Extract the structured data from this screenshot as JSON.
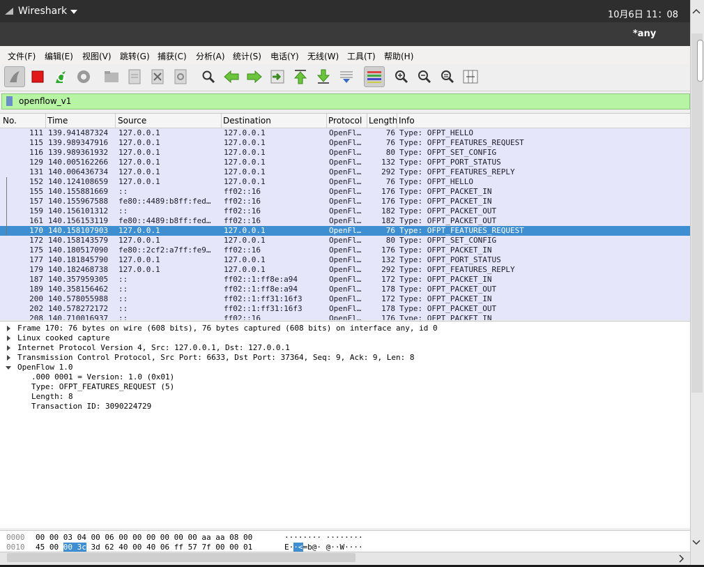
{
  "topbar": {
    "app_name": "Wireshark",
    "clock": "10月6日  11：08"
  },
  "window": {
    "title": "*any"
  },
  "menu": [
    "文件(F)",
    "编辑(E)",
    "视图(V)",
    "跳转(G)",
    "捕获(C)",
    "分析(A)",
    "统计(S)",
    "电话(Y)",
    "无线(W)",
    "工具(T)",
    "帮助(H)"
  ],
  "toolbar": {
    "icons": [
      "shark-fin-icon",
      "stop-capture-icon",
      "restart-capture-icon",
      "capture-options-icon",
      "open-file-icon",
      "save-file-icon",
      "close-file-icon",
      "reload-file-icon",
      "find-packet-icon",
      "go-back-icon",
      "go-forward-icon",
      "go-to-packet-icon",
      "go-first-icon",
      "go-last-icon",
      "auto-scroll-icon",
      "colorize-icon",
      "zoom-in-icon",
      "zoom-out-icon",
      "zoom-normal-icon",
      "resize-columns-icon"
    ]
  },
  "filter": {
    "value": "openflow_v1"
  },
  "packet_list": {
    "columns": [
      "No.",
      "Time",
      "Source",
      "Destination",
      "Protocol",
      "Length",
      "Info"
    ],
    "rows": [
      {
        "no": "111",
        "time": "139.941487324",
        "src": "127.0.0.1",
        "dst": "127.0.0.1",
        "proto": "OpenFl…",
        "len": "76",
        "info": "Type: OFPT_HELLO"
      },
      {
        "no": "115",
        "time": "139.989347916",
        "src": "127.0.0.1",
        "dst": "127.0.0.1",
        "proto": "OpenFl…",
        "len": "76",
        "info": "Type: OFPT_FEATURES_REQUEST"
      },
      {
        "no": "116",
        "time": "139.989361932",
        "src": "127.0.0.1",
        "dst": "127.0.0.1",
        "proto": "OpenFl…",
        "len": "80",
        "info": "Type: OFPT_SET_CONFIG"
      },
      {
        "no": "129",
        "time": "140.005162266",
        "src": "127.0.0.1",
        "dst": "127.0.0.1",
        "proto": "OpenFl…",
        "len": "132",
        "info": "Type: OFPT_PORT_STATUS"
      },
      {
        "no": "131",
        "time": "140.006436734",
        "src": "127.0.0.1",
        "dst": "127.0.0.1",
        "proto": "OpenFl…",
        "len": "292",
        "info": "Type: OFPT_FEATURES_REPLY"
      },
      {
        "no": "152",
        "time": "140.124108659",
        "src": "127.0.0.1",
        "dst": "127.0.0.1",
        "proto": "OpenFl…",
        "len": "76",
        "info": "Type: OFPT_HELLO"
      },
      {
        "no": "155",
        "time": "140.155881669",
        "src": "::",
        "dst": "ff02::16",
        "proto": "OpenFl…",
        "len": "176",
        "info": "Type: OFPT_PACKET_IN"
      },
      {
        "no": "157",
        "time": "140.155967588",
        "src": "fe80::4489:b8ff:fed…",
        "dst": "ff02::16",
        "proto": "OpenFl…",
        "len": "176",
        "info": "Type: OFPT_PACKET_IN"
      },
      {
        "no": "159",
        "time": "140.156101312",
        "src": "::",
        "dst": "ff02::16",
        "proto": "OpenFl…",
        "len": "182",
        "info": "Type: OFPT_PACKET_OUT"
      },
      {
        "no": "161",
        "time": "140.156153119",
        "src": "fe80::4489:b8ff:fed…",
        "dst": "ff02::16",
        "proto": "OpenFl…",
        "len": "182",
        "info": "Type: OFPT_PACKET_OUT"
      },
      {
        "no": "170",
        "time": "140.158107903",
        "src": "127.0.0.1",
        "dst": "127.0.0.1",
        "proto": "OpenFl…",
        "len": "76",
        "info": "Type: OFPT_FEATURES_REQUEST",
        "selected": true
      },
      {
        "no": "172",
        "time": "140.158143579",
        "src": "127.0.0.1",
        "dst": "127.0.0.1",
        "proto": "OpenFl…",
        "len": "80",
        "info": "Type: OFPT_SET_CONFIG"
      },
      {
        "no": "175",
        "time": "140.180517090",
        "src": "fe80::2cf2:a7ff:fe9…",
        "dst": "ff02::16",
        "proto": "OpenFl…",
        "len": "176",
        "info": "Type: OFPT_PACKET_IN"
      },
      {
        "no": "177",
        "time": "140.181845790",
        "src": "127.0.0.1",
        "dst": "127.0.0.1",
        "proto": "OpenFl…",
        "len": "132",
        "info": "Type: OFPT_PORT_STATUS"
      },
      {
        "no": "179",
        "time": "140.182468738",
        "src": "127.0.0.1",
        "dst": "127.0.0.1",
        "proto": "OpenFl…",
        "len": "292",
        "info": "Type: OFPT_FEATURES_REPLY"
      },
      {
        "no": "187",
        "time": "140.357959305",
        "src": "::",
        "dst": "ff02::1:ff8e:a94",
        "proto": "OpenFl…",
        "len": "172",
        "info": "Type: OFPT_PACKET_IN"
      },
      {
        "no": "189",
        "time": "140.358156462",
        "src": "::",
        "dst": "ff02::1:ff8e:a94",
        "proto": "OpenFl…",
        "len": "178",
        "info": "Type: OFPT_PACKET_OUT"
      },
      {
        "no": "200",
        "time": "140.578055988",
        "src": "::",
        "dst": "ff02::1:ff31:16f3",
        "proto": "OpenFl…",
        "len": "172",
        "info": "Type: OFPT_PACKET_IN"
      },
      {
        "no": "202",
        "time": "140.578272172",
        "src": "::",
        "dst": "ff02::1:ff31:16f3",
        "proto": "OpenFl…",
        "len": "178",
        "info": "Type: OFPT_PACKET_OUT"
      },
      {
        "no": "208",
        "time": "140.710016937",
        "src": "::",
        "dst": "ff02::16",
        "proto": "OpenFl…",
        "len": "176",
        "info": "Type: OFPT_PACKET_IN"
      }
    ]
  },
  "details": [
    {
      "text": "Frame 170: 76 bytes on wire (608 bits), 76 bytes captured (608 bits) on interface any, id 0",
      "level": 0,
      "state": "collapsed"
    },
    {
      "text": "Linux cooked capture",
      "level": 0,
      "state": "collapsed"
    },
    {
      "text": "Internet Protocol Version 4, Src: 127.0.0.1, Dst: 127.0.0.1",
      "level": 0,
      "state": "collapsed"
    },
    {
      "text": "Transmission Control Protocol, Src Port: 6633, Dst Port: 37364, Seq: 9, Ack: 9, Len: 8",
      "level": 0,
      "state": "collapsed"
    },
    {
      "text": "OpenFlow 1.0",
      "level": 0,
      "state": "expanded"
    },
    {
      "text": ".000 0001 = Version: 1.0 (0x01)",
      "level": 1,
      "state": "leaf"
    },
    {
      "text": "Type: OFPT_FEATURES_REQUEST (5)",
      "level": 1,
      "state": "leaf"
    },
    {
      "text": "Length: 8",
      "level": 1,
      "state": "leaf"
    },
    {
      "text": "Transaction ID: 3090224729",
      "level": 1,
      "state": "leaf"
    }
  ],
  "hex": [
    {
      "offset": "0000",
      "bytes_pre": "00 00 03 04 00 06 00 00  00 00 00 00 aa aa 08 00",
      "bytes_hl": "",
      "bytes_post": "",
      "ascii_pre": "········ ········",
      "ascii_hl": "",
      "ascii_post": ""
    },
    {
      "offset": "0010",
      "bytes_pre": "45 00 ",
      "bytes_hl": "00 3c",
      "bytes_post": " 3d 62 40 00  40 06 ff 57 7f 00 00 01",
      "ascii_pre": "E·",
      "ascii_hl": "·<",
      "ascii_post": "=b@· @··W····"
    }
  ],
  "colors": {
    "row_bg": "#e6e6fa",
    "selected_bg": "#3d8fd1",
    "filter_bg": "#b7f5a4",
    "topbar_bg": "#2e2e2e"
  }
}
